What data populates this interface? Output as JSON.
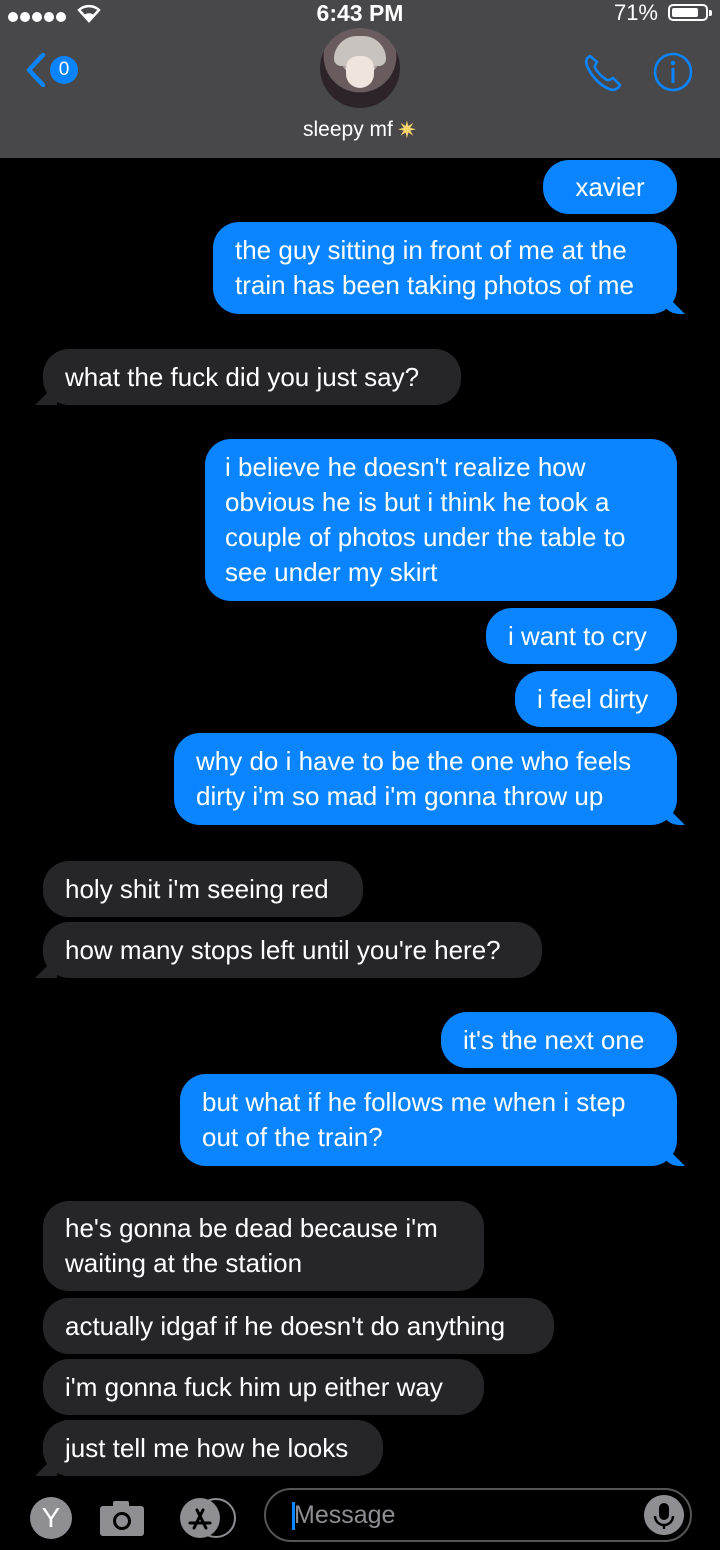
{
  "status_bar": {
    "time": "6:43 PM",
    "battery_percent": "71%"
  },
  "header": {
    "back_badge_count": "0",
    "contact_name": "sleepy mf",
    "contact_emoji_icon": "star-icon"
  },
  "messages": [
    {
      "dir": "out",
      "text": "xavier"
    },
    {
      "dir": "out",
      "text": "the guy sitting in front of me at the train has been taking photos of me"
    },
    {
      "dir": "in",
      "text": "what the fuck did you just say?"
    },
    {
      "dir": "out",
      "text": "i believe he doesn't realize how obvious he is but i think he took a couple of photos under the table to see under my skirt"
    },
    {
      "dir": "out",
      "text": "i want to cry"
    },
    {
      "dir": "out",
      "text": "i feel dirty"
    },
    {
      "dir": "out",
      "text": "why do i have to be the one who feels dirty i'm so mad i'm gonna throw up"
    },
    {
      "dir": "in",
      "text": "holy shit i'm seeing red"
    },
    {
      "dir": "in",
      "text": "how many stops left until you're here?"
    },
    {
      "dir": "out",
      "text": "it's the next one"
    },
    {
      "dir": "out",
      "text": "but what if he follows me when i step out of the train?"
    },
    {
      "dir": "in",
      "text": "he's gonna be dead because i'm waiting at the station"
    },
    {
      "dir": "in",
      "text": "actually idgaf if he doesn't do anything"
    },
    {
      "dir": "in",
      "text": "i'm gonna fuck him up either way"
    },
    {
      "dir": "in",
      "text": "just tell me how he looks"
    }
  ],
  "composer": {
    "avatar_letter": "Y",
    "placeholder": "Message"
  },
  "colors": {
    "outgoing": "#0a84ff",
    "incoming": "#262628",
    "header": "#48484a"
  }
}
